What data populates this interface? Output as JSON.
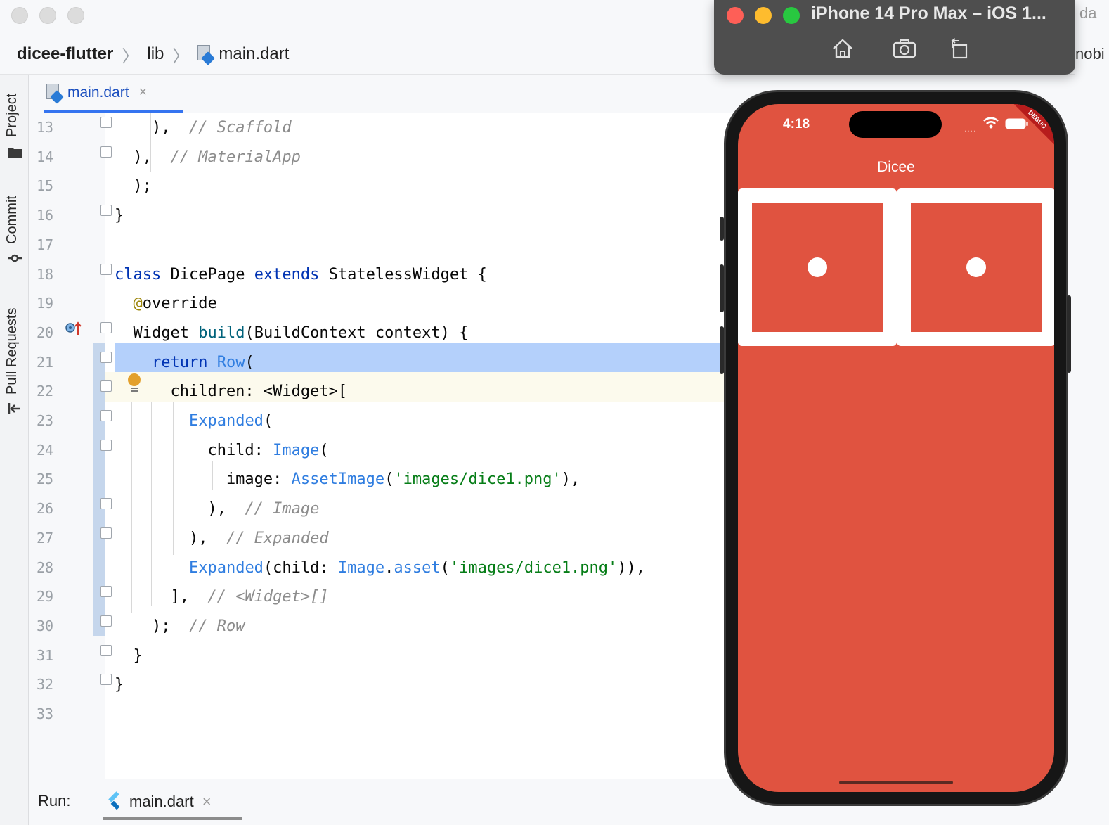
{
  "window": {
    "breadcrumb": {
      "project": "dicee-flutter",
      "folder": "lib",
      "file": "main.dart"
    }
  },
  "left_toolbar": {
    "items": [
      "Project",
      "Commit",
      "Pull Requests"
    ]
  },
  "editor": {
    "tab": {
      "label": "main.dart",
      "close": "×"
    },
    "lines": [
      {
        "n": "13",
        "html": "    ),  <span class='cm'>// Scaffold</span>"
      },
      {
        "n": "14",
        "html": "  ),  <span class='cm'>// MaterialApp</span>"
      },
      {
        "n": "15",
        "html": "  );"
      },
      {
        "n": "16",
        "html": "}"
      },
      {
        "n": "17",
        "html": ""
      },
      {
        "n": "18",
        "html": "<span class='kw'>class</span> DicePage <span class='kw'>extends</span> StatelessWidget {"
      },
      {
        "n": "19",
        "html": "  <span class='ann'>@</span>override"
      },
      {
        "n": "20",
        "html": "  Widget <span class='fn'>build</span>(BuildContext context) {"
      },
      {
        "n": "21",
        "html": "    <span class='kw'>return</span> <span class='ty'>Row</span>("
      },
      {
        "n": "22",
        "html": "      children: &lt;Widget&gt;["
      },
      {
        "n": "23",
        "html": "        <span class='ty'>Expanded</span>("
      },
      {
        "n": "24",
        "html": "          child: <span class='ty'>Image</span>("
      },
      {
        "n": "25",
        "html": "            image: <span class='ty'>AssetImage</span>(<span class='str'>'images/dice1.png'</span>),"
      },
      {
        "n": "26",
        "html": "          ),  <span class='cm'>// Image</span>"
      },
      {
        "n": "27",
        "html": "        ),  <span class='cm'>// Expanded</span>"
      },
      {
        "n": "28",
        "html": "        <span class='ty'>Expanded</span>(child: <span class='ty'>Image</span>.<span class='ty'>asset</span>(<span class='str'>'images/dice1.png'</span>)),"
      },
      {
        "n": "29",
        "html": "      ],  <span class='cm'>// &lt;Widget&gt;[]</span>"
      },
      {
        "n": "30",
        "html": "    );  <span class='cm'>// Row</span>"
      },
      {
        "n": "31",
        "html": "  }"
      },
      {
        "n": "32",
        "html": "}"
      },
      {
        "n": "33",
        "html": ""
      }
    ]
  },
  "run_panel": {
    "label": "Run:",
    "tab": "main.dart",
    "close": "×"
  },
  "simulator": {
    "title": "iPhone 14 Pro Max – iOS 1...",
    "behind_text": [
      "da",
      "nobi"
    ],
    "tools": [
      "home-icon",
      "screenshot-icon",
      "rotate-icon"
    ],
    "status_time": "4:18",
    "debug_banner": "DEBUG",
    "app_title": "Dicee",
    "dice": [
      1,
      1
    ],
    "colors": {
      "app_background": "#e05340",
      "dice_face": "#e05340",
      "pip": "#ffffff"
    }
  }
}
